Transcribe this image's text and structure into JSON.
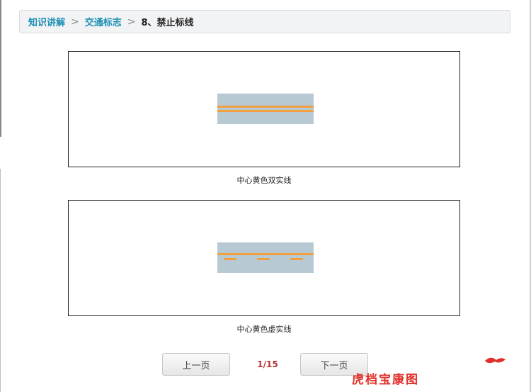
{
  "breadcrumb": {
    "items": [
      "知识讲解",
      "交通标志"
    ],
    "separator": ">",
    "current": "8、禁止标线"
  },
  "figures": [
    {
      "caption": "中心黄色双实线",
      "line_type": "double-solid-yellow"
    },
    {
      "caption": "中心黄色虚实线",
      "line_type": "solid-and-dashed-yellow"
    }
  ],
  "pagination": {
    "prev_label": "上一页",
    "next_label": "下一页",
    "indicator": "1/15"
  },
  "watermark": {
    "text": "虎档宝康图",
    "color": "#e0302a"
  },
  "colors": {
    "link": "#1c8fb3",
    "road": "#b7c9d3",
    "lane_marking": "#f0a040",
    "page_indicator": "#b03434"
  }
}
